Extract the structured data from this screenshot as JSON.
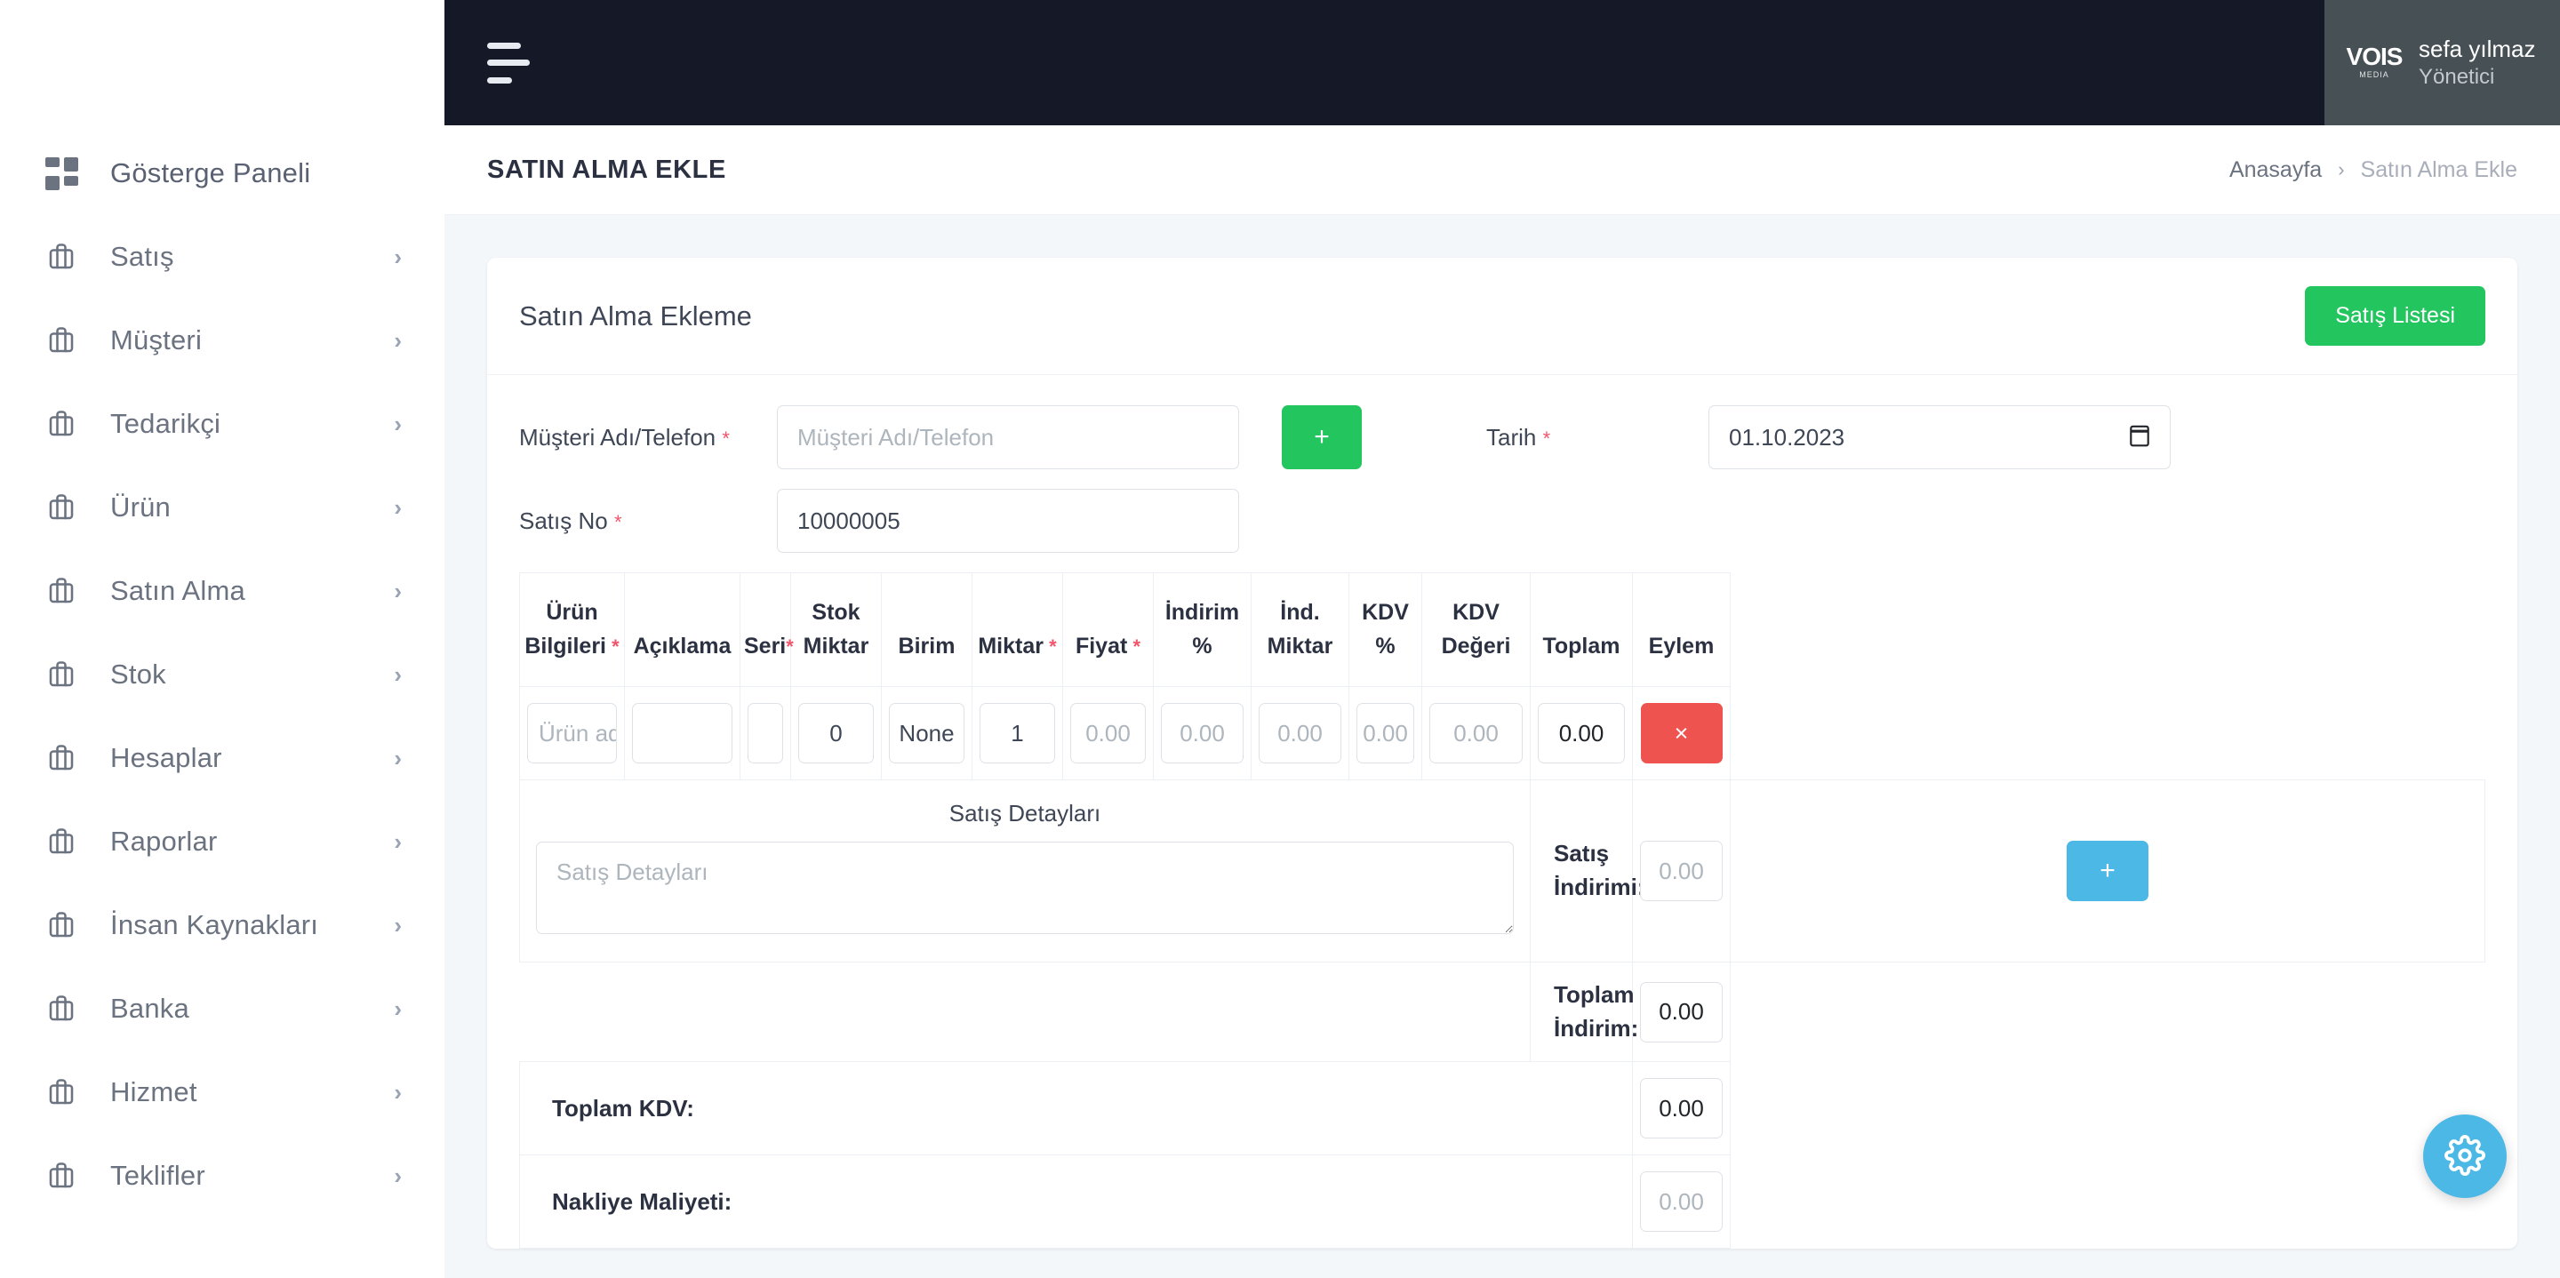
{
  "sidebar": {
    "items": [
      {
        "label": "Gösterge Paneli",
        "icon": "grid-icon",
        "chevron": false
      },
      {
        "label": "Satış",
        "icon": "briefcase-icon",
        "chevron": true
      },
      {
        "label": "Müşteri",
        "icon": "briefcase-icon",
        "chevron": true
      },
      {
        "label": "Tedarikçi",
        "icon": "briefcase-icon",
        "chevron": true
      },
      {
        "label": "Ürün",
        "icon": "briefcase-icon",
        "chevron": true
      },
      {
        "label": "Satın Alma",
        "icon": "briefcase-icon",
        "chevron": true
      },
      {
        "label": "Stok",
        "icon": "briefcase-icon",
        "chevron": true
      },
      {
        "label": "Hesaplar",
        "icon": "briefcase-icon",
        "chevron": true
      },
      {
        "label": "Raporlar",
        "icon": "briefcase-icon",
        "chevron": true
      },
      {
        "label": "İnsan Kaynakları",
        "icon": "briefcase-icon",
        "chevron": true
      },
      {
        "label": "Banka",
        "icon": "briefcase-icon",
        "chevron": true
      },
      {
        "label": "Hizmet",
        "icon": "briefcase-icon",
        "chevron": true
      },
      {
        "label": "Teklifler",
        "icon": "briefcase-icon",
        "chevron": true
      }
    ]
  },
  "topbar": {
    "menu_icon": "hamburger-icon",
    "profile": {
      "logo_main": "VOIS",
      "logo_sub": "MEDIA",
      "name": "sefa yılmaz",
      "role": "Yönetici"
    }
  },
  "pagehead": {
    "title": "SATIN ALMA EKLE",
    "breadcrumb_home": "Anasayfa",
    "breadcrumb_sep": "›",
    "breadcrumb_current": "Satın Alma Ekle"
  },
  "card": {
    "title": "Satın Alma Ekleme",
    "list_button": "Satış Listesi"
  },
  "form": {
    "customer_label": "Müşteri Adı/Telefon",
    "customer_placeholder": "Müşteri Adı/Telefon",
    "customer_value": "",
    "add_customer_button": "+",
    "date_label": "Tarih",
    "date_value": "01.10.2023",
    "sale_no_label": "Satış No",
    "sale_no_value": "10000005",
    "required_mark": "*"
  },
  "table": {
    "headers": [
      {
        "line1": "Ürün",
        "line2": "Bilgileri",
        "required": true
      },
      {
        "line1": "",
        "line2": "Açıklama",
        "required": false
      },
      {
        "line1": "",
        "line2": "Seri",
        "required": true
      },
      {
        "line1": "Stok",
        "line2": "Miktar",
        "required": false
      },
      {
        "line1": "",
        "line2": "Birim",
        "required": false
      },
      {
        "line1": "",
        "line2": "Miktar",
        "required": true
      },
      {
        "line1": "",
        "line2": "Fiyat",
        "required": true
      },
      {
        "line1": "",
        "line2": "İndirim %",
        "required": false
      },
      {
        "line1": "",
        "line2": "İnd. Miktar",
        "required": false
      },
      {
        "line1": "",
        "line2": "KDV %",
        "required": false
      },
      {
        "line1": "",
        "line2": "KDV Değeri",
        "required": false
      },
      {
        "line1": "",
        "line2": "Toplam",
        "required": false
      },
      {
        "line1": "",
        "line2": "Eylem",
        "required": false
      }
    ],
    "row": {
      "product_placeholder": "Ürün adı",
      "product_value": "",
      "description_value": "",
      "serial_value": "",
      "stock_qty_value": "0",
      "unit_value": "None",
      "quantity_value": "1",
      "price_placeholder": "0.00",
      "price_value": "",
      "discount_pct_placeholder": "0.00",
      "discount_pct_value": "",
      "discount_amount_placeholder": "0.00",
      "discount_amount_value": "",
      "vat_pct_placeholder": "0.00",
      "vat_pct_value": "",
      "vat_value_placeholder": "0.00",
      "vat_value_value": "",
      "total_value": "0.00",
      "remove_button": "×"
    }
  },
  "details": {
    "label": "Satış Detayları",
    "placeholder": "Satış Detayları",
    "value": ""
  },
  "totals": {
    "sale_discount_label": "Satış İndirimi:",
    "sale_discount_placeholder": "0.00",
    "sale_discount_value": "",
    "add_row_button": "+",
    "total_discount_label": "Toplam İndirim:",
    "total_discount_value": "0.00",
    "total_vat_label": "Toplam KDV:",
    "total_vat_value": "0.00",
    "shipping_label": "Nakliye Maliyeti:",
    "shipping_value": "0.00"
  },
  "fab": {
    "icon": "gear-icon"
  },
  "colors": {
    "topbar": "#141827",
    "profile_bg": "#465055",
    "green": "#22c55e",
    "red": "#ef5350",
    "blue": "#4cb8e6",
    "required": "#f1556c",
    "page_bg": "#f4f7fa"
  }
}
